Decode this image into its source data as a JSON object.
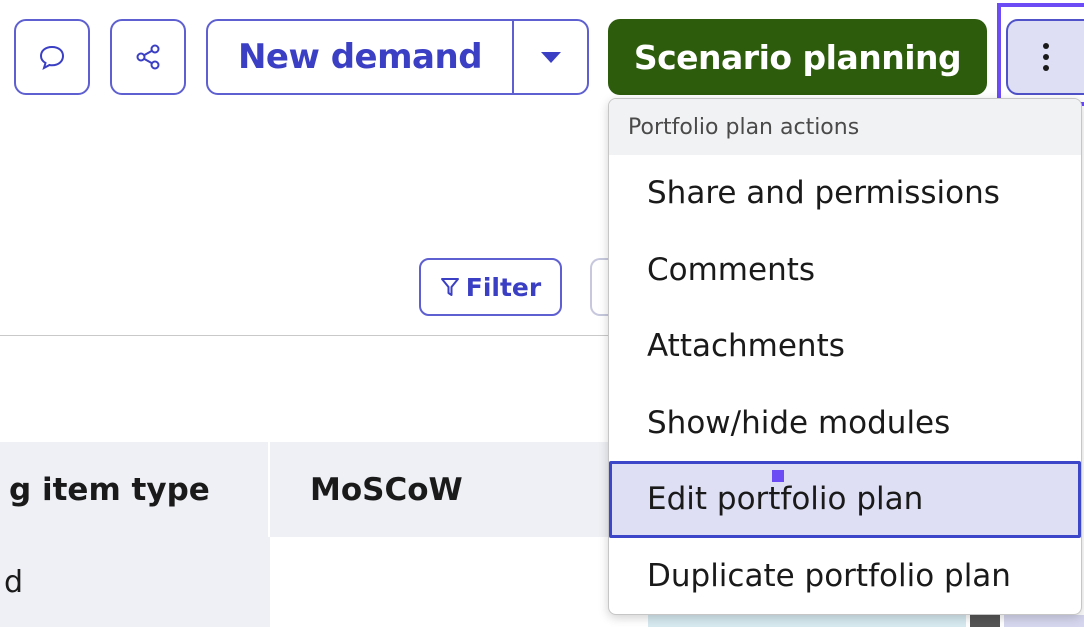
{
  "toolbar": {
    "comment_icon": "speech-bubble-icon",
    "share_icon": "share-icon",
    "new_demand_label": "New demand",
    "caret_icon": "caret-down-icon",
    "scenario_planning_label": "Scenario planning",
    "more_icon": "vertical-ellipsis-icon"
  },
  "filter": {
    "label": "Filter",
    "icon": "filter-funnel-icon"
  },
  "table": {
    "columns": [
      "g item type",
      "MoSCoW"
    ],
    "rows": [
      [
        "d",
        ""
      ]
    ]
  },
  "menu": {
    "header": "Portfolio plan actions",
    "items": [
      {
        "label": "Share and permissions"
      },
      {
        "label": "Comments"
      },
      {
        "label": "Attachments"
      },
      {
        "label": "Show/hide modules"
      },
      {
        "label": "Edit portfolio plan"
      },
      {
        "label": "Duplicate portfolio plan"
      }
    ],
    "active_item": "Edit portfolio plan"
  },
  "colors": {
    "accent": "#3b3fc4",
    "primary": "#2c5c0c",
    "focus": "#6b4cf5",
    "highlight": "#dedff4"
  }
}
